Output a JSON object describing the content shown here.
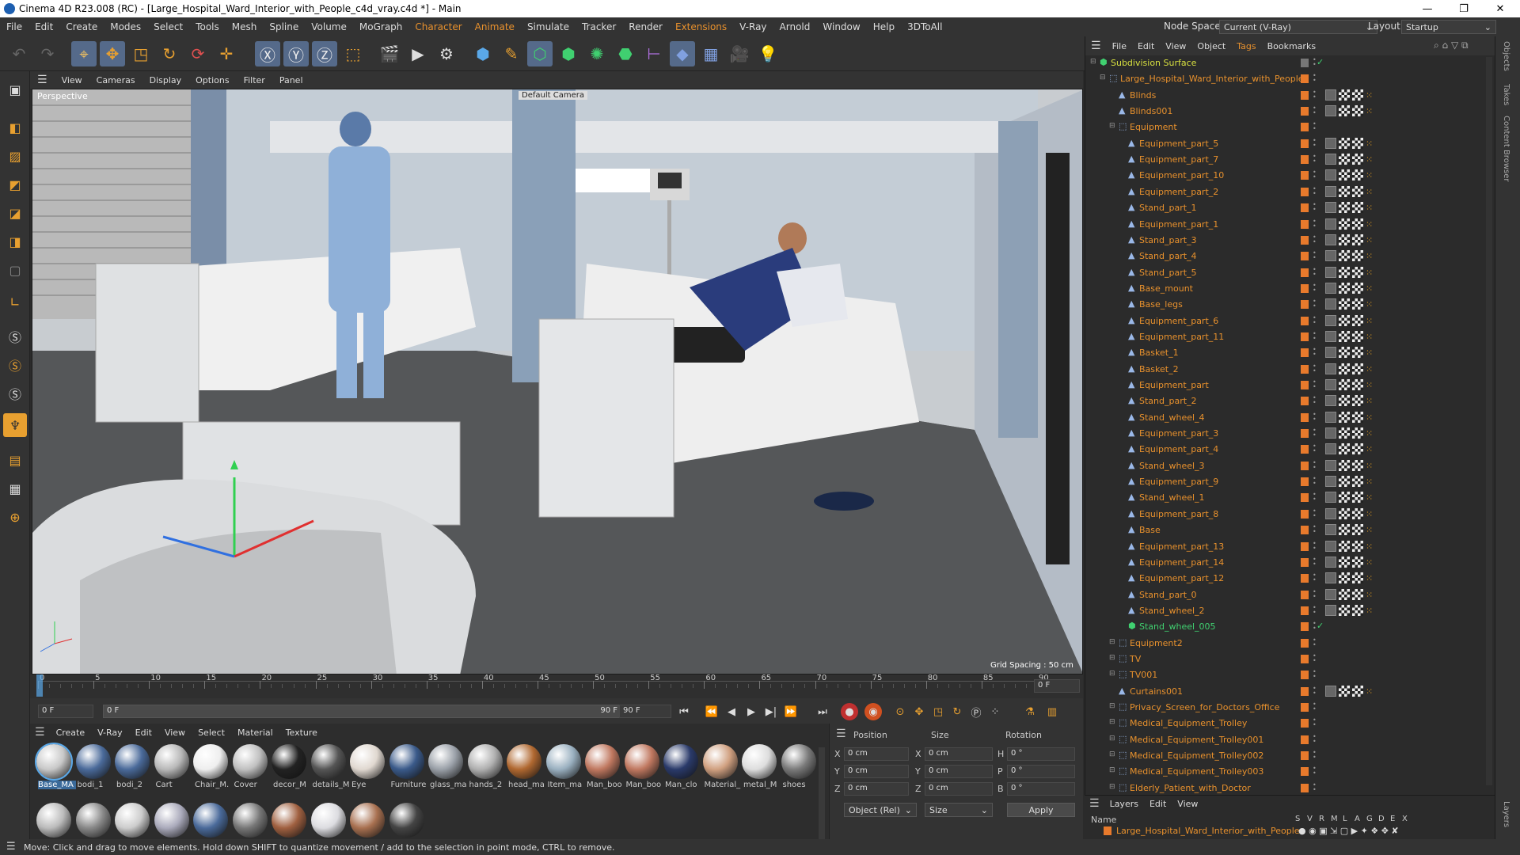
{
  "window": {
    "title": "Cinema 4D R23.008 (RC) - [Large_Hospital_Ward_Interior_with_People_c4d_vray.c4d *] - Main",
    "minimize": "—",
    "maximize": "❐",
    "close": "✕"
  },
  "menu": [
    "File",
    "Edit",
    "Create",
    "Modes",
    "Select",
    "Tools",
    "Mesh",
    "Spline",
    "Volume",
    "MoGraph",
    "Character",
    "Animate",
    "Simulate",
    "Tracker",
    "Render",
    "Extensions",
    "V-Ray",
    "Arnold",
    "Window",
    "Help",
    "3DToAll"
  ],
  "nodespace": {
    "label": "Node Space:",
    "value": "Current (V-Ray)",
    "layout_label": "Layout:",
    "layout_value": "Startup"
  },
  "viewport": {
    "menu": [
      "View",
      "Cameras",
      "Display",
      "Options",
      "Filter",
      "Panel"
    ],
    "label": "Perspective",
    "camera": "Default Camera",
    "grid_spacing": "Grid Spacing : 50 cm"
  },
  "timeline": {
    "ticks": [
      "0",
      "5",
      "10",
      "15",
      "20",
      "25",
      "30",
      "35",
      "40",
      "45",
      "50",
      "55",
      "60",
      "65",
      "70",
      "75",
      "80",
      "85",
      "90"
    ],
    "current_frame": "0 F",
    "start_field": "0 F",
    "bar_start": "0 F",
    "bar_end": "90 F",
    "end_field": "90 F"
  },
  "materials": {
    "menu": [
      "Create",
      "V-Ray",
      "Edit",
      "View",
      "Select",
      "Material",
      "Texture"
    ],
    "row1": [
      "Base_MA",
      "bodi_1",
      "bodi_2",
      "Cart",
      "Chair_M.",
      "Cover",
      "decor_M",
      "details_M",
      "Eye",
      "Furniture",
      "glass_ma",
      "hands_2",
      "head_ma",
      "Item_ma",
      "Man_boo",
      "Man_boo",
      "Man_clo",
      "Material_",
      "metal_M",
      "shoes"
    ]
  },
  "coords": {
    "headers": [
      "Position",
      "Size",
      "Rotation"
    ],
    "axes": [
      "X",
      "Y",
      "Z"
    ],
    "pos": [
      "0 cm",
      "0 cm",
      "0 cm"
    ],
    "size": [
      "0 cm",
      "0 cm",
      "0 cm"
    ],
    "rot_axes": [
      "H",
      "P",
      "B"
    ],
    "rot": [
      "0 °",
      "0 °",
      "0 °"
    ],
    "mode": "Object (Rel)",
    "size_mode": "Size",
    "apply": "Apply"
  },
  "objects": {
    "menu": [
      "File",
      "Edit",
      "View",
      "Object",
      "Tags",
      "Bookmarks"
    ],
    "rows": [
      {
        "name": "Subdivision Surface",
        "indent": 0,
        "type": "green",
        "tags": "check"
      },
      {
        "name": "Large_Hospital_Ward_Interior_with_People",
        "indent": 1,
        "type": "null",
        "tags": ""
      },
      {
        "name": "Blinds",
        "indent": 2,
        "type": "poly",
        "tags": "full"
      },
      {
        "name": "Blinds001",
        "indent": 2,
        "type": "poly",
        "tags": "full"
      },
      {
        "name": "Equipment",
        "indent": 2,
        "type": "null",
        "tags": ""
      },
      {
        "name": "Equipment_part_5",
        "indent": 3,
        "type": "poly",
        "tags": "full"
      },
      {
        "name": "Equipment_part_7",
        "indent": 3,
        "type": "poly",
        "tags": "full"
      },
      {
        "name": "Equipment_part_10",
        "indent": 3,
        "type": "poly",
        "tags": "full"
      },
      {
        "name": "Equipment_part_2",
        "indent": 3,
        "type": "poly",
        "tags": "full"
      },
      {
        "name": "Stand_part_1",
        "indent": 3,
        "type": "poly",
        "tags": "full"
      },
      {
        "name": "Equipment_part_1",
        "indent": 3,
        "type": "poly",
        "tags": "full"
      },
      {
        "name": "Stand_part_3",
        "indent": 3,
        "type": "poly",
        "tags": "full"
      },
      {
        "name": "Stand_part_4",
        "indent": 3,
        "type": "poly",
        "tags": "full"
      },
      {
        "name": "Stand_part_5",
        "indent": 3,
        "type": "poly",
        "tags": "full"
      },
      {
        "name": "Base_mount",
        "indent": 3,
        "type": "poly",
        "tags": "full"
      },
      {
        "name": "Base_legs",
        "indent": 3,
        "type": "poly",
        "tags": "full"
      },
      {
        "name": "Equipment_part_6",
        "indent": 3,
        "type": "poly",
        "tags": "full"
      },
      {
        "name": "Equipment_part_11",
        "indent": 3,
        "type": "poly",
        "tags": "full"
      },
      {
        "name": "Basket_1",
        "indent": 3,
        "type": "poly",
        "tags": "full"
      },
      {
        "name": "Basket_2",
        "indent": 3,
        "type": "poly",
        "tags": "full"
      },
      {
        "name": "Equipment_part",
        "indent": 3,
        "type": "poly",
        "tags": "full"
      },
      {
        "name": "Stand_part_2",
        "indent": 3,
        "type": "poly",
        "tags": "full"
      },
      {
        "name": "Stand_wheel_4",
        "indent": 3,
        "type": "poly",
        "tags": "full"
      },
      {
        "name": "Equipment_part_3",
        "indent": 3,
        "type": "poly",
        "tags": "full"
      },
      {
        "name": "Equipment_part_4",
        "indent": 3,
        "type": "poly",
        "tags": "full"
      },
      {
        "name": "Stand_wheel_3",
        "indent": 3,
        "type": "poly",
        "tags": "full"
      },
      {
        "name": "Equipment_part_9",
        "indent": 3,
        "type": "poly",
        "tags": "full"
      },
      {
        "name": "Stand_wheel_1",
        "indent": 3,
        "type": "poly",
        "tags": "full"
      },
      {
        "name": "Equipment_part_8",
        "indent": 3,
        "type": "poly",
        "tags": "full"
      },
      {
        "name": "Base",
        "indent": 3,
        "type": "poly",
        "tags": "full"
      },
      {
        "name": "Equipment_part_13",
        "indent": 3,
        "type": "poly",
        "tags": "full"
      },
      {
        "name": "Equipment_part_14",
        "indent": 3,
        "type": "poly",
        "tags": "full"
      },
      {
        "name": "Equipment_part_12",
        "indent": 3,
        "type": "poly",
        "tags": "full"
      },
      {
        "name": "Stand_part_0",
        "indent": 3,
        "type": "poly",
        "tags": "full"
      },
      {
        "name": "Stand_wheel_2",
        "indent": 3,
        "type": "poly",
        "tags": "full"
      },
      {
        "name": "Stand_wheel_005",
        "indent": 3,
        "type": "green",
        "tags": "check"
      },
      {
        "name": "Equipment2",
        "indent": 2,
        "type": "null",
        "tags": ""
      },
      {
        "name": "TV",
        "indent": 2,
        "type": "null",
        "tags": ""
      },
      {
        "name": "TV001",
        "indent": 2,
        "type": "null",
        "tags": ""
      },
      {
        "name": "Curtains001",
        "indent": 2,
        "type": "poly",
        "tags": "full"
      },
      {
        "name": "Privacy_Screen_for_Doctors_Office",
        "indent": 2,
        "type": "null",
        "tags": ""
      },
      {
        "name": "Medical_Equipment_Trolley",
        "indent": 2,
        "type": "null",
        "tags": ""
      },
      {
        "name": "Medical_Equipment_Trolley001",
        "indent": 2,
        "type": "null",
        "tags": ""
      },
      {
        "name": "Medical_Equipment_Trolley002",
        "indent": 2,
        "type": "null",
        "tags": ""
      },
      {
        "name": "Medical_Equipment_Trolley003",
        "indent": 2,
        "type": "null",
        "tags": ""
      },
      {
        "name": "Elderly_Patient_with_Doctor",
        "indent": 2,
        "type": "null",
        "tags": ""
      }
    ]
  },
  "layers": {
    "menu": [
      "Layers",
      "Edit",
      "View"
    ],
    "col_name": "Name",
    "cols": [
      "S",
      "V",
      "R",
      "M",
      "L",
      "A",
      "G",
      "D",
      "E",
      "X"
    ],
    "row": "Large_Hospital_Ward_Interior_with_People"
  },
  "right_tabs": [
    "Objects",
    "Takes",
    "Content Browser",
    "Layers"
  ],
  "status": "Move: Click and drag to move elements. Hold down SHIFT to quantize movement / add to the selection in point mode, CTRL to remove."
}
